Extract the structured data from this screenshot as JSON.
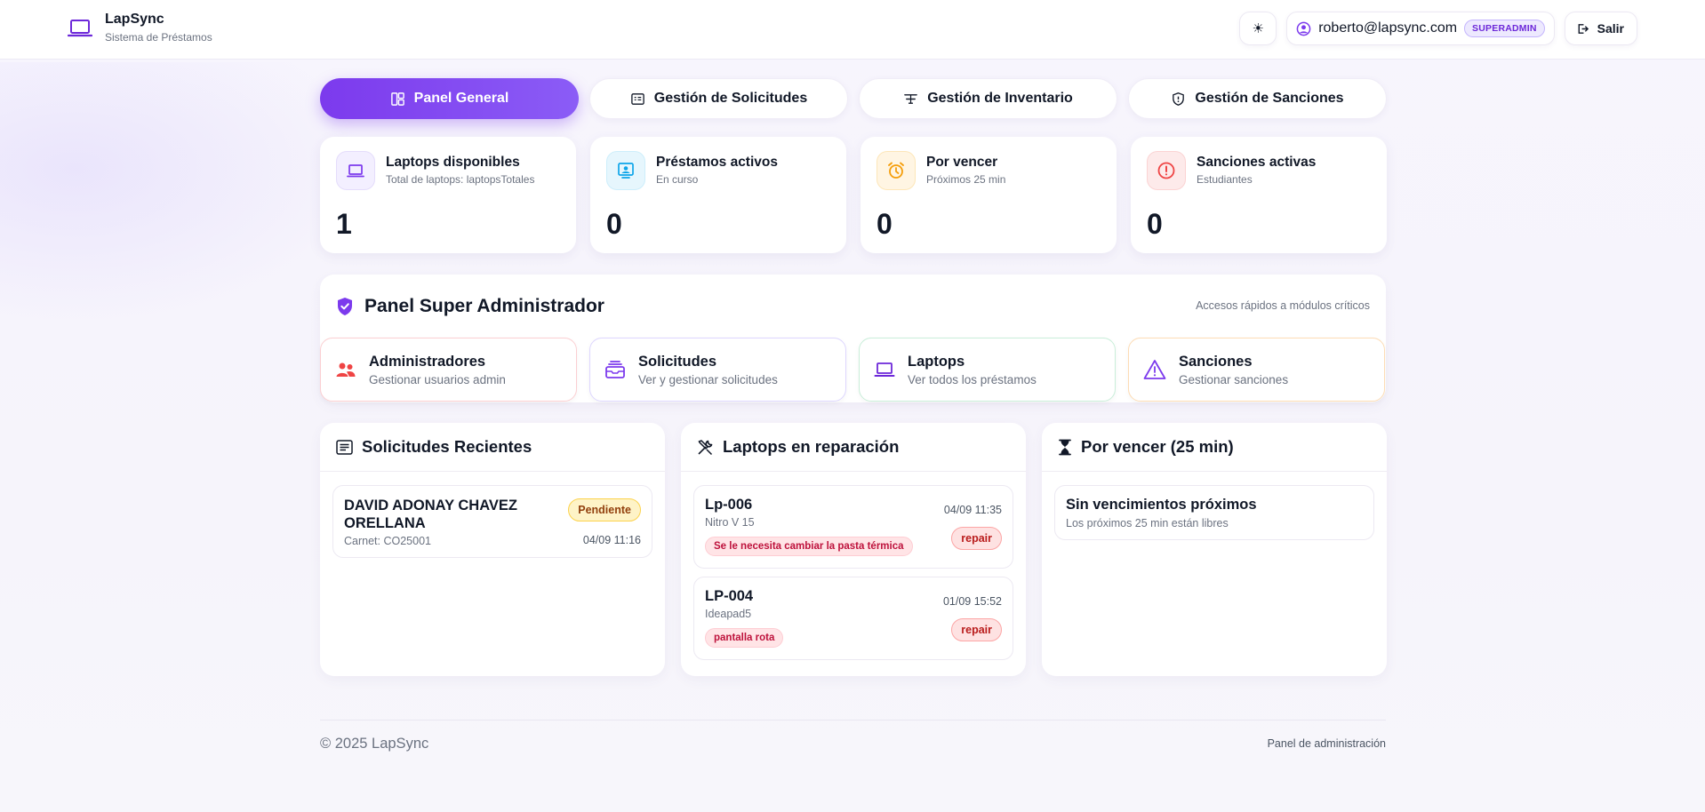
{
  "brand": {
    "title": "LapSync",
    "subtitle": "Sistema de Préstamos"
  },
  "header": {
    "theme_toggle_icon": "sun-icon",
    "user_email": "roberto@lapsync.com",
    "role": "SUPERADMIN",
    "logout_label": "Salir"
  },
  "tabs": [
    {
      "label": "Panel General",
      "icon": "dashboard-icon",
      "active": true
    },
    {
      "label": "Gestión de Solicitudes",
      "icon": "requests-icon",
      "active": false
    },
    {
      "label": "Gestión de Inventario",
      "icon": "inventory-icon",
      "active": false
    },
    {
      "label": "Gestión de Sanciones",
      "icon": "shield-icon",
      "active": false
    }
  ],
  "stats": [
    {
      "title": "Laptops disponibles",
      "subtitle": "Total de laptops: laptopsTotales",
      "value": "1",
      "icon": "laptop-icon",
      "color": "#7c3aed"
    },
    {
      "title": "Préstamos activos",
      "subtitle": "En curso",
      "value": "0",
      "icon": "user-card-icon",
      "color": "#0ea5e9"
    },
    {
      "title": "Por vencer",
      "subtitle": "Próximos 25 min",
      "value": "0",
      "icon": "alarm-icon",
      "color": "#f59e0b"
    },
    {
      "title": "Sanciones activas",
      "subtitle": "Estudiantes",
      "value": "0",
      "icon": "alert-circle-icon",
      "color": "#ef4444"
    }
  ],
  "super_admin": {
    "title": "Panel Super Administrador",
    "hint": "Accesos rápidos a módulos críticos",
    "cards": [
      {
        "title": "Administradores",
        "subtitle": "Gestionar usuarios admin",
        "icon": "users-icon"
      },
      {
        "title": "Solicitudes",
        "subtitle": "Ver y gestionar solicitudes",
        "icon": "inbox-icon"
      },
      {
        "title": "Laptops",
        "subtitle": "Ver todos los préstamos",
        "icon": "laptop-icon"
      },
      {
        "title": "Sanciones",
        "subtitle": "Gestionar sanciones",
        "icon": "warning-icon"
      }
    ]
  },
  "recent_requests": {
    "title": "Solicitudes Recientes",
    "items": [
      {
        "name": "DAVID ADONAY CHAVEZ ORELLANA",
        "carnet": "Carnet: CO25001",
        "status": "Pendiente",
        "time": "04/09 11:16"
      }
    ]
  },
  "repairs": {
    "title": "Laptops en reparación",
    "items": [
      {
        "code": "Lp-006",
        "model": "Nitro V 15",
        "note": "Se le necesita cambiar la pasta térmica",
        "time": "04/09 11:35",
        "status": "repair"
      },
      {
        "code": "LP-004",
        "model": "Ideapad5",
        "note": "pantalla rota",
        "time": "01/09 15:52",
        "status": "repair"
      }
    ]
  },
  "expiring": {
    "title": "Por vencer (25 min)",
    "empty_title": "Sin vencimientos próximos",
    "empty_sub": "Los próximos 25 min están libres"
  },
  "footer": {
    "copyright": "© 2025 LapSync",
    "right": "Panel de administración"
  }
}
